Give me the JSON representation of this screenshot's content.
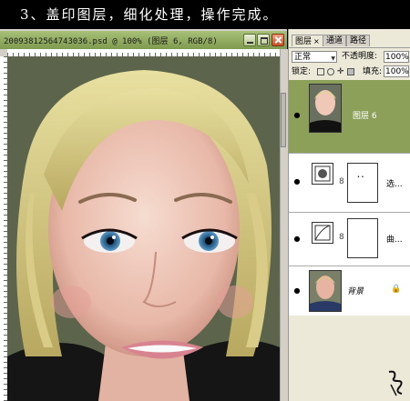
{
  "banner": {
    "text": "3、盖印图层，细化处理，操作完成。"
  },
  "document": {
    "title": "20093812564743036.psd @ 100% (图层 6, RGB/8)"
  },
  "panel": {
    "tabs": [
      {
        "label": "图层",
        "close": "×"
      },
      {
        "label": "通道"
      },
      {
        "label": "路径"
      }
    ],
    "blend_mode": "正常",
    "opacity_label": "不透明度:",
    "opacity_value": "100%",
    "lock_label": "锁定:",
    "fill_label": "填充:",
    "fill_value": "100%",
    "layers": [
      {
        "name": "图层 6",
        "selected": true
      },
      {
        "name": "选..."
      },
      {
        "name": "曲..."
      },
      {
        "name": "背景"
      }
    ]
  },
  "colors": {
    "selected_layer": "#8ca05a",
    "titlebar": "#8fa860"
  }
}
